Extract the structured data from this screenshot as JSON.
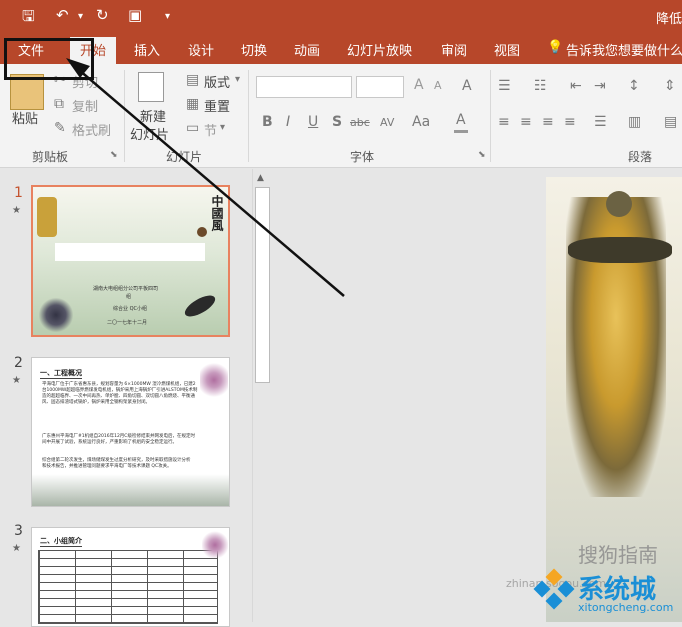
{
  "titlebar": {
    "title": "降低",
    "save_icon": "save-icon",
    "undo_icon": "undo-icon",
    "redo_icon": "redo-icon",
    "present_icon": "presentation-icon"
  },
  "tabs": [
    "文件",
    "开始",
    "插入",
    "设计",
    "切换",
    "动画",
    "幻灯片放映",
    "审阅",
    "视图"
  ],
  "tell_me": "告诉我您想要做什么",
  "ribbon": {
    "clipboard": {
      "paste": "粘贴",
      "cut": "剪切",
      "copy": "复制",
      "format_painter": "格式刷",
      "label": "剪贴板"
    },
    "slides": {
      "new_slide_line1": "新建",
      "new_slide_line2": "幻灯片",
      "layout": "版式",
      "reset": "重置",
      "section": "节",
      "label": "幻灯片"
    },
    "font": {
      "label": "字体",
      "bold": "B",
      "italic": "I",
      "underline": "U",
      "shadow": "S",
      "strike": "abc",
      "spacing": "AV",
      "case": "Aa",
      "grow": "A",
      "shrink": "A",
      "clear": "A"
    },
    "paragraph": {
      "label": "段落"
    }
  },
  "thumbs": [
    {
      "num": "1",
      "star": "★",
      "title": "中國風",
      "line1": "湖南大电组组分公司平板四司",
      "line2": "组",
      "line3": "综合业 QC小组",
      "line4": "二〇一七年十二月"
    },
    {
      "num": "2",
      "star": "★",
      "heading": "一、工程概况",
      "p1": "平海电厂位于广东省惠东县，规划容量为 6×1000MW 湿冷燃煤机组，已建2台1000MW超超临界燃煤发电机组，锅炉采用上海锅炉厂引进ALSTOM技术制造的超超临界、一次中间再热、单炉膛、四角切圆、双切圆八角燃烧、平衡通风、固态排渣塔式锅炉，锅炉采用全钢构架紧身封闭。",
      "p2": "广东惠州平海电厂#1机组自2016年12月C级检修结束并网发电后，在规定时间中开展了试验，系统运行良好，严重影响了机组的安全稳定运行。",
      "p3": "综合组第二轮次发生，煤场储煤发生过度分析研究，及时采取措施设计分析和技术报告，并推进管理问题要求平海电厂等技术课题 QC攻关。"
    },
    {
      "num": "3",
      "star": "★",
      "heading": "二、小组简介"
    }
  ],
  "watermarks": {
    "sogou": "搜狗指南",
    "site": "zhinan.sogou.com",
    "xitong": "系统城",
    "xitong_url": "xitongcheng.com"
  },
  "colors": {
    "accent": "#b7472a",
    "ribbon_bg": "#f3f3f3",
    "pane_bg": "#e6e6e6",
    "selected_thumb": "#e8825f"
  }
}
